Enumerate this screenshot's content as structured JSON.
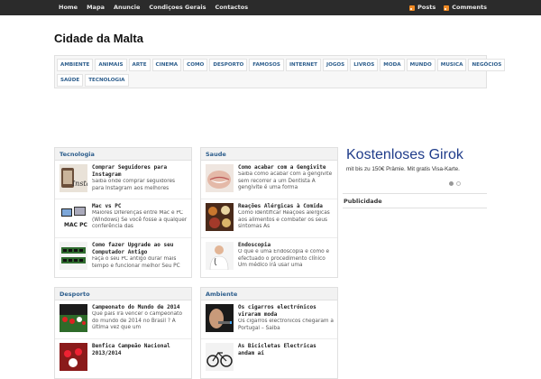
{
  "topnav": [
    "Home",
    "Mapa",
    "Anuncie",
    "Condiçoes Gerais",
    "Contactos"
  ],
  "feeds": {
    "posts": "Posts",
    "comments": "Comments"
  },
  "site": {
    "title": "Cidade da Malta"
  },
  "categories": {
    "row1": [
      "AMBIENTE",
      "ANIMAIS",
      "ARTE",
      "CINEMA",
      "COMO",
      "DESPORTO",
      "FAMOSOS",
      "INTERNET",
      "JOGOS",
      "LIVROS",
      "MODA",
      "MUNDO",
      "MUSICA",
      "NEGÓCIOS"
    ],
    "row2": [
      "SAÚDE",
      "TECNOLOGIA"
    ]
  },
  "panels": {
    "tecnologia": {
      "title": "Tecnologia",
      "posts": [
        {
          "title": "Comprar Seguidores para Instagram",
          "excerpt": "Saiba onde comprar seguidores para Instagram aos melhores"
        },
        {
          "title": "Mac vs PC",
          "excerpt": "Maiores Diferenças entre Mac e PC (Windows) Se você fosse a qualquer conferência das"
        },
        {
          "title": "Como fazer Upgrade ao seu Computador Antigo",
          "excerpt": "Faça o seu PC antigo durar mais tempo e funcionar melhor Seu PC"
        }
      ]
    },
    "saude": {
      "title": "Saude",
      "posts": [
        {
          "title": "Como acabar com a Gengivite",
          "excerpt": "Saiba como acabar com a gengivite sem recorrer a um Dentista A gengivite é uma forma"
        },
        {
          "title": "Reações Alérgicas à Comida",
          "excerpt": "Como identificar Reações alérgicas aos alimentos e combater os seus sintomas As"
        },
        {
          "title": "Endoscopia",
          "excerpt": "O que é uma Endoscopia e como é efectuado o procedimento clínico Um médico irá usar uma"
        }
      ]
    },
    "desporto": {
      "title": "Desporto",
      "posts": [
        {
          "title": "Campeonato do Mundo de 2014",
          "excerpt": "Que país irá vencer o campeonato do mundo de 2014 no Brasil ? A última vez que um"
        },
        {
          "title": "Benfica Campeão Nacional 2013/2014",
          "excerpt": ""
        }
      ]
    },
    "ambiente": {
      "title": "Ambiente",
      "posts": [
        {
          "title": "Os cigarros electrónicos viraram moda",
          "excerpt": "Os cigarros electrónicos chegaram a Portugal – Saiba"
        },
        {
          "title": "As Bicicletas Electricas andam aí",
          "excerpt": ""
        }
      ]
    }
  },
  "ad": {
    "headline": "Kostenloses Girok",
    "subline": "mit bis zu 150€ Prämie. Mit gratis Visa-Karte."
  },
  "sidebar": {
    "publicidade": "Publicidade"
  },
  "colors": {
    "accent": "#2c5d8c",
    "topbar": "#2b2b2b",
    "rss": "#f08a24",
    "ad_blue": "#1f3c8a"
  }
}
